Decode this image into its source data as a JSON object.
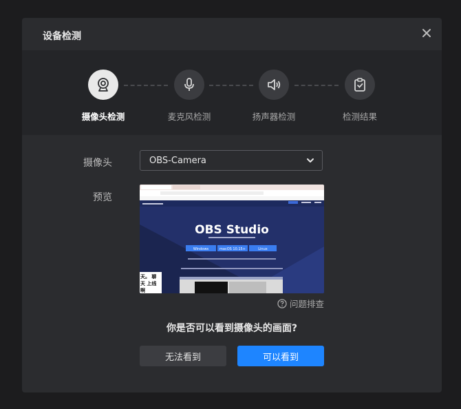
{
  "dialog": {
    "title": "设备检测",
    "close_icon": "close-icon"
  },
  "steps": [
    {
      "label": "摄像头检测",
      "icon": "webcam-icon",
      "active": true
    },
    {
      "label": "麦克风检测",
      "icon": "microphone-icon",
      "active": false
    },
    {
      "label": "扬声器检测",
      "icon": "speaker-icon",
      "active": false
    },
    {
      "label": "检测结果",
      "icon": "clipboard-check-icon",
      "active": false
    }
  ],
  "camera": {
    "label": "摄像头",
    "selected": "OBS-Camera",
    "dropdown_icon": "chevron-down-icon"
  },
  "preview": {
    "label": "预览",
    "heading": "OBS Studio",
    "buttons": [
      "Windows",
      "macOS 10.15+",
      "Linux"
    ],
    "overlay_text": "天。 聊天 上线啊"
  },
  "help": {
    "label": "问题排查",
    "icon": "question-circle-icon"
  },
  "question": "你是否可以看到摄像头的画面?",
  "actions": {
    "cannot_see": "无法看到",
    "can_see": "可以看到"
  },
  "colors": {
    "accent": "#1e85ff",
    "dialog_bg": "#2b2c2f",
    "header_bg": "#242528"
  }
}
